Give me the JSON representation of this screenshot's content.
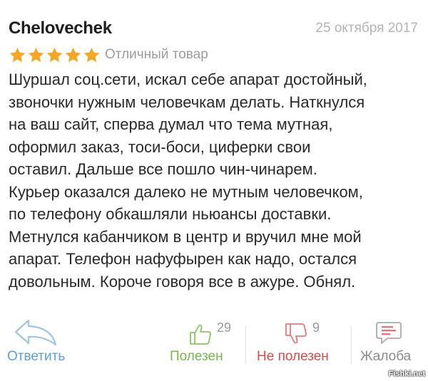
{
  "review": {
    "author": "Chelovechek",
    "date": "25 октября 2017",
    "rating": 5,
    "rating_max": 5,
    "rating_label": "Отличный товар",
    "text": "Шуршал соц.сети, искал себе апарат достойный,\nзвоночки нужным человечкам делать. Наткнулся\nна ваш сайт, сперва думал что тема мутная,\nоформил заказ, тоси-боси, циферки свои\nоставил. Дальше все пошло чин-чинарем.\nКурьер оказался далеко не мутным человечком,\nпо телефону обкашляли ньюансы доставки.\nМетнулся кабанчиком в центр и вручил мне мой\nапарат. Телефон нафуфырен как надо, остался\nдовольным. Короче говоря все в ажуре. Обнял."
  },
  "actions": {
    "reply_label": "Ответить",
    "helpful_label": "Полезен",
    "helpful_count": "29",
    "not_helpful_label": "Не полезен",
    "not_helpful_count": "9",
    "complain_label": "Жалоба"
  },
  "watermark": "Fishki.net",
  "colors": {
    "star": "#f5a623",
    "reply": "#5aa0d8",
    "helpful": "#76b84a",
    "not_helpful": "#d94a4a",
    "complain": "#8a8a8a"
  },
  "icons": {
    "reply": "reply-arrow-icon",
    "helpful": "thumbs-up-icon",
    "not_helpful": "thumbs-down-icon",
    "complain": "complaint-bubble-icon"
  }
}
